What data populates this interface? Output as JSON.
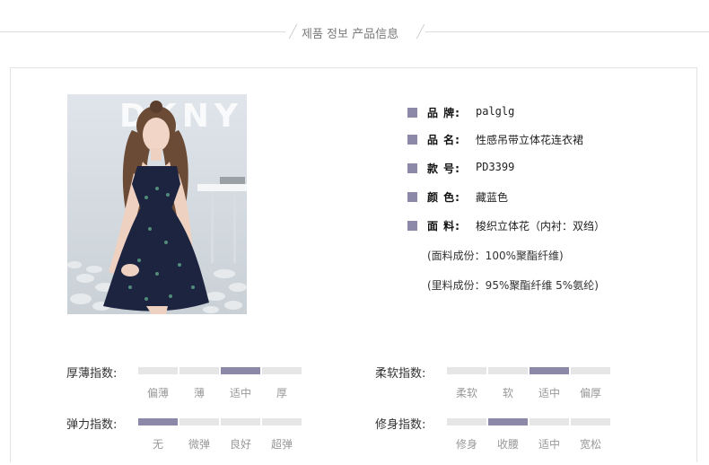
{
  "header": {
    "title": "제품 정보 产品信息"
  },
  "photo": {
    "backdrop_text": "DKNY"
  },
  "specs": [
    {
      "label": "品 牌:",
      "value": "palglg"
    },
    {
      "label": "品 名:",
      "value": "性感吊带立体花连衣裙"
    },
    {
      "label": "款 号:",
      "value": "PD3399"
    },
    {
      "label": "颜 色:",
      "value": "藏蓝色"
    },
    {
      "label": "面 料:",
      "value": "梭织立体花（内衬：双绉）"
    }
  ],
  "notes": [
    "(面料成份：100%聚酯纤维)",
    "(里料成份：95%聚酯纤维 5%氨纶)"
  ],
  "scales": [
    {
      "label": "厚薄指数:",
      "options": [
        "偏薄",
        "薄",
        "适中",
        "厚"
      ],
      "selected_index": 2
    },
    {
      "label": "柔软指数:",
      "options": [
        "柔软",
        "软",
        "适中",
        "偏厚"
      ],
      "selected_index": 2
    },
    {
      "label": "弹力指数:",
      "options": [
        "无",
        "微弹",
        "良好",
        "超弹"
      ],
      "selected_index": 0
    },
    {
      "label": "修身指数:",
      "options": [
        "修身",
        "收腰",
        "适中",
        "宽松"
      ],
      "selected_index": 1
    }
  ],
  "colors": {
    "accent": "#8c88a8",
    "track": "#e6e6e6",
    "dress": "#1d2440"
  }
}
